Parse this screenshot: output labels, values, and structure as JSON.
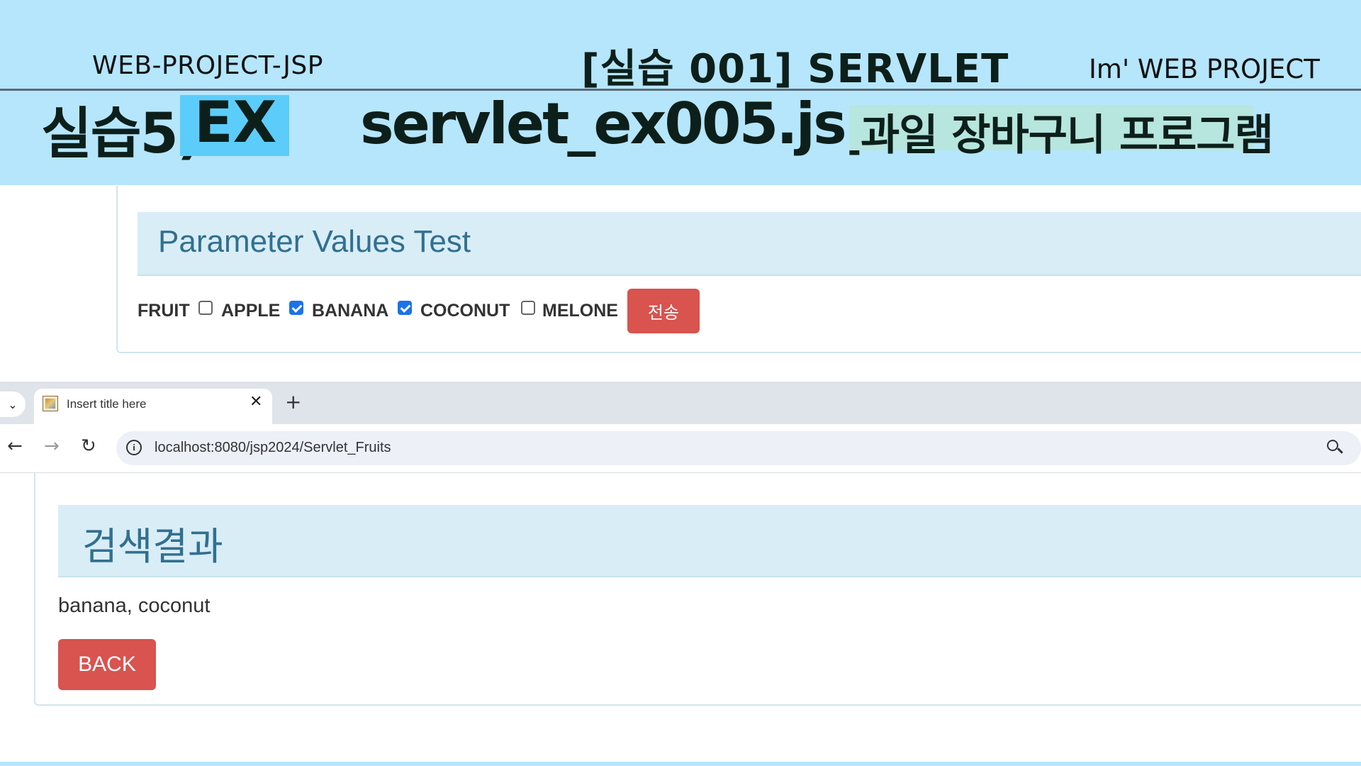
{
  "banner": {
    "project_label": "WEB-PROJECT-JSP",
    "lesson_title": "[실습 001]  SERVLET",
    "brand": "Im' WEB PROJECT",
    "practice_label": "실습5)",
    "ex_label": "EX",
    "filename": "servlet_ex005.jsp",
    "subtitle": "과일 장바구니 프로그램",
    "colors": {
      "banner_bg": "#b5e6fc",
      "ex_highlight": "#5ccdfb",
      "subtitle_highlight": "#b7e6de"
    }
  },
  "form_panel": {
    "title": "Parameter Values Test",
    "field_label": "FRUIT",
    "options": [
      {
        "label": "APPLE",
        "checked": false
      },
      {
        "label": "BANANA",
        "checked": true
      },
      {
        "label": "COCONUT",
        "checked": true
      },
      {
        "label": "MELONE",
        "checked": false
      }
    ],
    "submit_label": "전송"
  },
  "browser": {
    "tab_title": "Insert title here",
    "tab_close": "✕",
    "new_tab": "+",
    "tab_dropdown": "⌄",
    "url": "localhost:8080/jsp2024/Servlet_Fruits",
    "nav": {
      "back": "←",
      "forward": "→",
      "reload": "↻",
      "info": "i"
    }
  },
  "result_panel": {
    "title": "검색결과",
    "result_text": "banana, coconut",
    "back_label": "BACK"
  }
}
